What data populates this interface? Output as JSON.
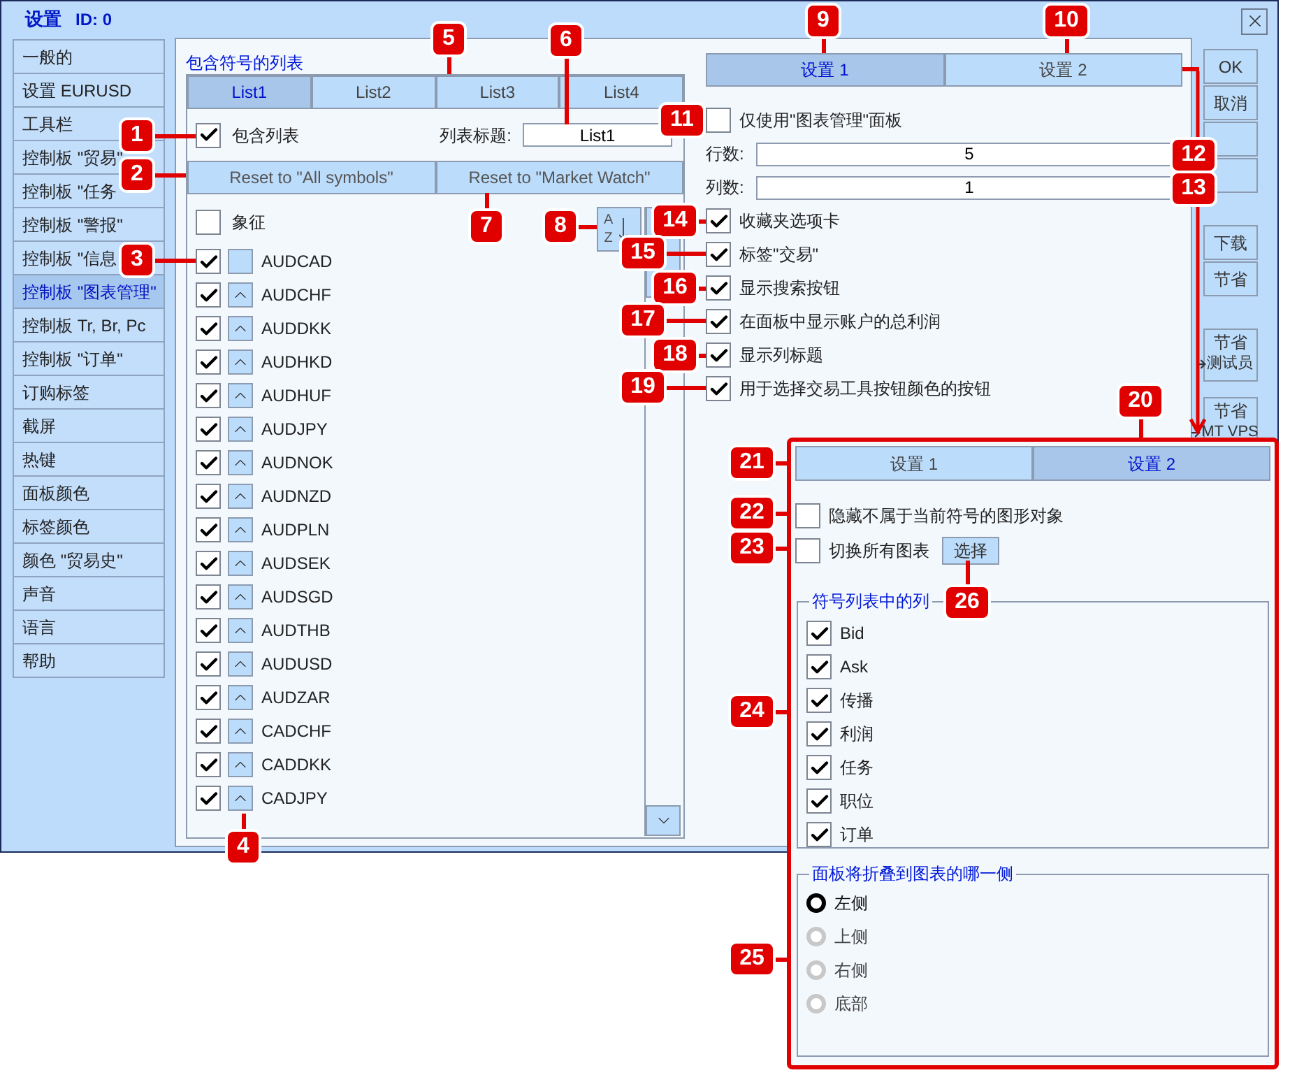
{
  "window": {
    "title": "设置",
    "id": "ID: 0"
  },
  "sidebar": {
    "items": [
      {
        "label": "一般的",
        "selected": false
      },
      {
        "label": "设置 EURUSD",
        "selected": false
      },
      {
        "label": "工具栏",
        "selected": false
      },
      {
        "label": "控制板 \"贸易\"",
        "selected": false
      },
      {
        "label": "控制板 \"任务",
        "selected": false
      },
      {
        "label": "控制板 \"警报\"",
        "selected": false
      },
      {
        "label": "控制板 \"信息",
        "selected": false
      },
      {
        "label": "控制板 \"图表管理\"",
        "selected": true
      },
      {
        "label": "控制板 Tr, Br, Pc",
        "selected": false
      },
      {
        "label": "控制板 \"订单\"",
        "selected": false
      },
      {
        "label": "订购标签",
        "selected": false
      },
      {
        "label": "截屏",
        "selected": false
      },
      {
        "label": "热键",
        "selected": false
      },
      {
        "label": "面板颜色",
        "selected": false
      },
      {
        "label": "标签颜色",
        "selected": false
      },
      {
        "label": "颜色 \"贸易史\"",
        "selected": false
      },
      {
        "label": "声音",
        "selected": false
      },
      {
        "label": "语言",
        "selected": false
      },
      {
        "label": "帮助",
        "selected": false
      }
    ]
  },
  "symbols_panel": {
    "title": "包含符号的列表",
    "tabs": [
      {
        "label": "List1",
        "selected": true
      },
      {
        "label": "List2",
        "selected": false
      },
      {
        "label": "List3",
        "selected": false
      },
      {
        "label": "List4",
        "selected": false
      }
    ],
    "include": {
      "label": "包含列表",
      "checked": true
    },
    "list_title": {
      "label": "列表标题:",
      "value": "List1"
    },
    "reset_buttons": [
      "Reset to \"All symbols\"",
      "Reset to \"Market Watch\""
    ],
    "header": {
      "label": "象征",
      "checked": false
    },
    "sort_button": {
      "top": "A",
      "bottom": "Z"
    },
    "symbols": [
      {
        "name": "AUDCAD",
        "checked": true,
        "movable": false
      },
      {
        "name": "AUDCHF",
        "checked": true,
        "movable": true
      },
      {
        "name": "AUDDKK",
        "checked": true,
        "movable": true
      },
      {
        "name": "AUDHKD",
        "checked": true,
        "movable": true
      },
      {
        "name": "AUDHUF",
        "checked": true,
        "movable": true
      },
      {
        "name": "AUDJPY",
        "checked": true,
        "movable": true
      },
      {
        "name": "AUDNOK",
        "checked": true,
        "movable": true
      },
      {
        "name": "AUDNZD",
        "checked": true,
        "movable": true
      },
      {
        "name": "AUDPLN",
        "checked": true,
        "movable": true
      },
      {
        "name": "AUDSEK",
        "checked": true,
        "movable": true
      },
      {
        "name": "AUDSGD",
        "checked": true,
        "movable": true
      },
      {
        "name": "AUDTHB",
        "checked": true,
        "movable": true
      },
      {
        "name": "AUDUSD",
        "checked": true,
        "movable": true
      },
      {
        "name": "AUDZAR",
        "checked": true,
        "movable": true
      },
      {
        "name": "CADCHF",
        "checked": true,
        "movable": true
      },
      {
        "name": "CADDKK",
        "checked": true,
        "movable": true
      },
      {
        "name": "CADJPY",
        "checked": true,
        "movable": true
      }
    ]
  },
  "settings_panel": {
    "tabs": [
      {
        "label": "设置 1",
        "selected": true
      },
      {
        "label": "设置 2",
        "selected": false
      }
    ],
    "rows": [
      {
        "kind": "checkbox",
        "label": "仅使用\"图表管理\"面板",
        "checked": false
      },
      {
        "kind": "input",
        "label": "行数:",
        "value": "5"
      },
      {
        "kind": "input",
        "label": "列数:",
        "value": "1"
      },
      {
        "kind": "checkbox",
        "label": "收藏夹选项卡",
        "checked": true
      },
      {
        "kind": "checkbox",
        "label": "标签\"交易\"",
        "checked": true
      },
      {
        "kind": "checkbox",
        "label": "显示搜索按钮",
        "checked": true
      },
      {
        "kind": "checkbox",
        "label": "在面板中显示账户的总利润",
        "checked": true
      },
      {
        "kind": "checkbox",
        "label": "显示列标题",
        "checked": true
      },
      {
        "kind": "checkbox",
        "label": "用于选择交易工具按钮颜色的按钮",
        "checked": true
      }
    ]
  },
  "buttons": [
    {
      "kind": "text",
      "label": "OK"
    },
    {
      "kind": "text",
      "label": "取消"
    },
    {
      "kind": "covered"
    },
    {
      "kind": "covered"
    },
    {
      "kind": "text",
      "label": "下载"
    },
    {
      "kind": "text",
      "label": "节省"
    },
    {
      "kind": "export",
      "label": "节省",
      "target": "测试员"
    },
    {
      "kind": "export",
      "label": "节省",
      "target": "MT VPS"
    }
  ],
  "settings_2_panel": {
    "tabs": [
      {
        "label": "设置 1",
        "selected": false
      },
      {
        "label": "设置 2",
        "selected": true
      }
    ],
    "options": [
      {
        "label": "隐藏不属于当前符号的图形对象",
        "checked": false
      },
      {
        "label": "切换所有图表",
        "checked": false,
        "button": "选择"
      }
    ],
    "columns_group": {
      "title": "符号列表中的列",
      "items": [
        {
          "label": "Bid",
          "checked": true
        },
        {
          "label": "Ask",
          "checked": true
        },
        {
          "label": "传播",
          "checked": true
        },
        {
          "label": "利润",
          "checked": true
        },
        {
          "label": "任务",
          "checked": true
        },
        {
          "label": "职位",
          "checked": true
        },
        {
          "label": "订单",
          "checked": true
        }
      ]
    },
    "side_group": {
      "title": "面板将折叠到图表的哪一侧",
      "options": [
        {
          "label": "左侧",
          "selected": true,
          "disabled": false
        },
        {
          "label": "上侧",
          "selected": false,
          "disabled": true
        },
        {
          "label": "右侧",
          "selected": false,
          "disabled": true
        },
        {
          "label": "底部",
          "selected": false,
          "disabled": true
        }
      ]
    }
  },
  "callouts": [
    "1",
    "2",
    "3",
    "4",
    "5",
    "6",
    "7",
    "8",
    "9",
    "10",
    "11",
    "12",
    "13",
    "14",
    "15",
    "16",
    "17",
    "18",
    "19",
    "20",
    "21",
    "22",
    "23",
    "24",
    "25",
    "26"
  ]
}
